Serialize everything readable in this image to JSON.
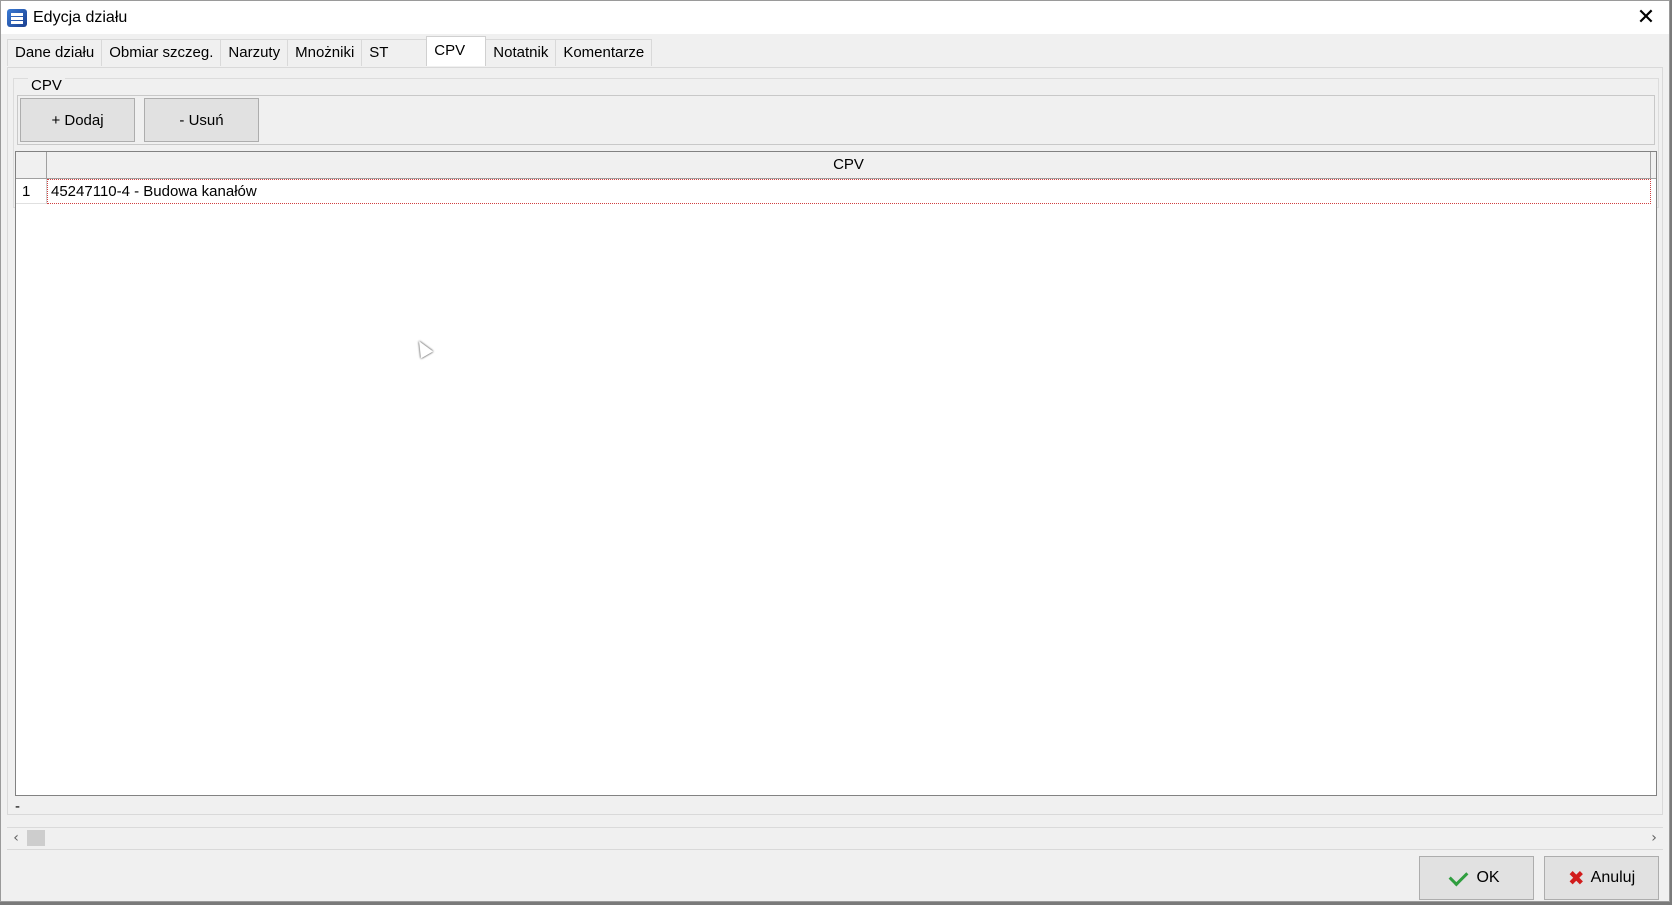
{
  "window": {
    "title": "Edycja działu"
  },
  "tabs": [
    {
      "label": "Dane działu"
    },
    {
      "label": "Obmiar szczeg."
    },
    {
      "label": "Narzuty"
    },
    {
      "label": "Mnożniki"
    },
    {
      "label": "ST"
    },
    {
      "label": "CPV"
    },
    {
      "label": "Notatnik"
    },
    {
      "label": "Komentarze"
    }
  ],
  "active_tab": "CPV",
  "group": {
    "label": "CPV"
  },
  "toolbar": {
    "add_label": "+ Dodaj",
    "remove_label": "- Usuń"
  },
  "grid": {
    "column_header": "CPV",
    "rows": [
      {
        "num": "1",
        "value": "45247110-4 - Budowa kanałów"
      }
    ],
    "footer": "-"
  },
  "buttons": {
    "ok": "OK",
    "cancel": "Anuluj"
  },
  "icons": {
    "app": "app-icon",
    "close": "close-icon",
    "ok": "check-icon",
    "cancel": "x-icon"
  }
}
